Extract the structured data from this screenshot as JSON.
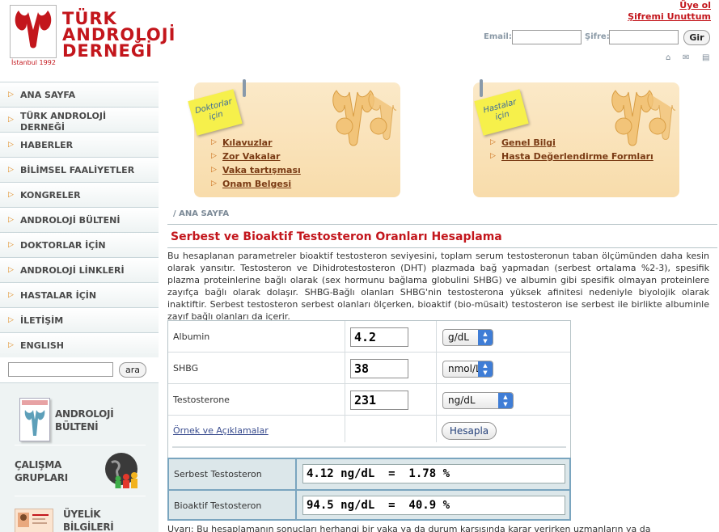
{
  "header": {
    "logo_lines": [
      "TÜRK",
      "ANDROLOJİ",
      "DERNEĞİ"
    ],
    "logo_year": "İstanbul 1992",
    "link_register": "Üye ol",
    "link_forgot": "Şifremi Unuttum",
    "email_label": "Email:",
    "password_label": "Şifre:",
    "login_button": "Gir",
    "email_value": "",
    "password_value": ""
  },
  "nav": {
    "items": [
      {
        "label": "ANA SAYFA"
      },
      {
        "label": "TÜRK ANDROLOJİ DERNEĞİ"
      },
      {
        "label": "HABERLER"
      },
      {
        "label": "BİLİMSEL FAALİYETLER"
      },
      {
        "label": "KONGRELER"
      },
      {
        "label": "ANDROLOJİ BÜLTENİ"
      },
      {
        "label": "DOKTORLAR İÇİN"
      },
      {
        "label": "ANDROLOJİ LİNKLERİ"
      },
      {
        "label": "HASTALAR İÇİN"
      },
      {
        "label": "İLETİŞİM"
      },
      {
        "label": "ENGLISH"
      }
    ],
    "search_value": "",
    "search_button": "ara"
  },
  "promos": [
    {
      "line1": "ANDROLOJİ",
      "line2": "BÜLTENİ"
    },
    {
      "line1": "ÇALIŞMA",
      "line2": "GRUPLARI"
    },
    {
      "line1": "ÜYELİK",
      "line2": "BİLGİLERİ"
    }
  ],
  "banner": {
    "doctors_tag": "Doktorlar için",
    "doctors_links": [
      "Kılavuzlar",
      "Zor Vakalar",
      "Vaka tartışması",
      "Onam Belgesi"
    ],
    "patients_tag": "Hastalar için",
    "patients_links": [
      "Genel Bilgi",
      "Hasta Değerlendirme Formları"
    ]
  },
  "breadcrumb": "/ ANA SAYFA",
  "title": "Serbest ve Bioaktif Testosteron Oranları Hesaplama",
  "intro": "Bu hesaplanan parametreler bioaktif testosteron seviyesini, toplam serum testosteronun taban ölçümünden daha kesin olarak yansıtır. Testosteron ve Dihidrotestosteron (DHT) plazmada bağ yapmadan (serbest ortalama %2-3), spesifik plazma proteinlerine bağlı olarak (sex hormunu bağlama globulini SHBG) ve albumin gibi spesifik olmayan proteinlere zayıfça bağlı olarak dolaşır. SHBG-Bağlı olanları SHBG'nin testosterona yüksek afinitesi nedeniyle biyolojik olarak inaktiftir. Serbest testosteron serbest olanları ölçerken, bioaktif (bio-müsait) testosteron ise serbest ile birlikte albuminle zayıf bağlı olanları da içerir.",
  "calculator": {
    "rows": [
      {
        "label": "Albumin",
        "value": "4.2",
        "unit": "g/dL"
      },
      {
        "label": "SHBG",
        "value": "38",
        "unit": "nmol/L"
      },
      {
        "label": "Testosterone",
        "value": "231",
        "unit": "ng/dL"
      }
    ],
    "examples_link": "Örnek ve Açıklamalar",
    "calculate_button": "Hesapla"
  },
  "results": [
    {
      "label": "Serbest Testosteron",
      "value": "4.12 ng/dL  =  1.78 %"
    },
    {
      "label": "Bioaktif Testosteron",
      "value": "94.5 ng/dL  =  40.9 %"
    }
  ],
  "warning": "Uyarı: Bu hesaplamanın sonuçları herhangi bir vaka ya da durum karşısında karar verirken uzmanların ya da"
}
